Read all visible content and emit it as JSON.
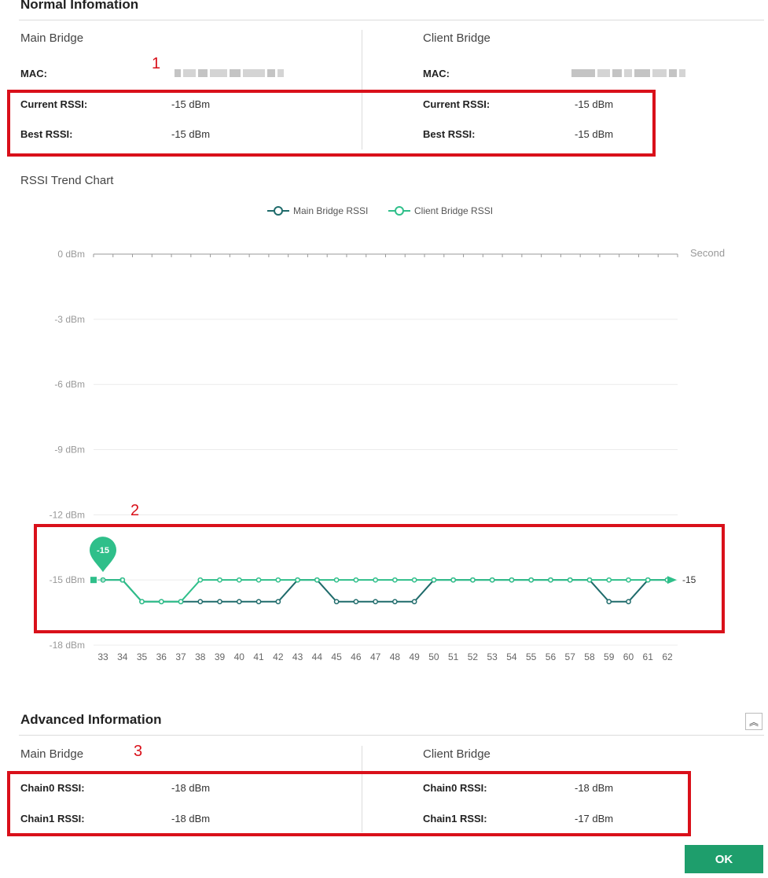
{
  "normal": {
    "title": "Normal Infomation",
    "main": {
      "title": "Main Bridge",
      "mac_label": "MAC:",
      "current_label": "Current RSSI:",
      "current_value": "-15 dBm",
      "best_label": "Best RSSI:",
      "best_value": "-15 dBm"
    },
    "client": {
      "title": "Client Bridge",
      "mac_label": "MAC:",
      "current_label": "Current RSSI:",
      "current_value": "-15 dBm",
      "best_label": "Best RSSI:",
      "best_value": "-15 dBm"
    }
  },
  "annotations": {
    "a1": "1",
    "a2": "2",
    "a3": "3"
  },
  "chart_title": "RSSI Trend Chart",
  "chart_data": {
    "type": "line",
    "title": "",
    "xlabel": "Second",
    "ylabel": "",
    "x": [
      33,
      34,
      35,
      36,
      37,
      38,
      39,
      40,
      41,
      42,
      43,
      44,
      45,
      46,
      47,
      48,
      49,
      50,
      51,
      52,
      53,
      54,
      55,
      56,
      57,
      58,
      59,
      60,
      61,
      62
    ],
    "yticks": [
      "0 dBm",
      "-3 dBm",
      "-6 dBm",
      "-9 dBm",
      "-12 dBm",
      "-15 dBm",
      "-18 dBm"
    ],
    "ylim": [
      -18,
      0
    ],
    "series": [
      {
        "name": "Main Bridge RSSI",
        "color": "#1f6b6b",
        "values": [
          -15,
          -15,
          -16,
          -16,
          -16,
          -16,
          -16,
          -16,
          -16,
          -16,
          -15,
          -15,
          -16,
          -16,
          -16,
          -16,
          -16,
          -15,
          -15,
          -15,
          -15,
          -15,
          -15,
          -15,
          -15,
          -15,
          -16,
          -16,
          -15,
          -15
        ]
      },
      {
        "name": "Client Bridge RSSI",
        "color": "#2fbf8a",
        "values": [
          -15,
          -15,
          -16,
          -16,
          -16,
          -15,
          -15,
          -15,
          -15,
          -15,
          -15,
          -15,
          -15,
          -15,
          -15,
          -15,
          -15,
          -15,
          -15,
          -15,
          -15,
          -15,
          -15,
          -15,
          -15,
          -15,
          -15,
          -15,
          -15,
          -15
        ]
      }
    ],
    "marker_label": "-15",
    "end_label": "-15",
    "legend": "top-center",
    "grid": true
  },
  "advanced": {
    "title": "Advanced Information",
    "collapse_icon": "double-chevron-up-icon",
    "main": {
      "title": "Main Bridge",
      "chain0_label": "Chain0 RSSI:",
      "chain0_value": "-18 dBm",
      "chain1_label": "Chain1 RSSI:",
      "chain1_value": "-18 dBm"
    },
    "client": {
      "title": "Client Bridge",
      "chain0_label": "Chain0 RSSI:",
      "chain0_value": "-18 dBm",
      "chain1_label": "Chain1 RSSI:",
      "chain1_value": "-17 dBm"
    }
  },
  "ok_label": "OK",
  "colors": {
    "accent": "#1e9e6c",
    "highlight": "#d9101a"
  }
}
